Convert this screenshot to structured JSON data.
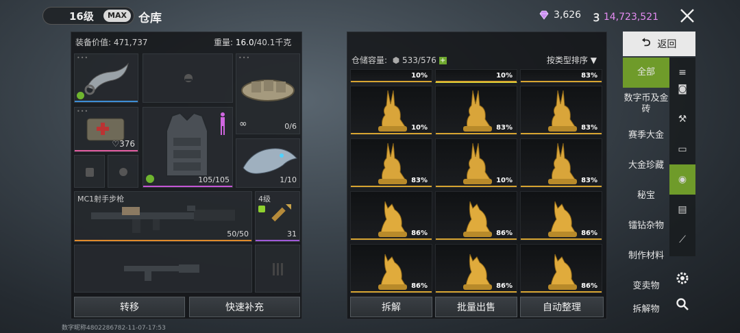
{
  "header": {
    "level": "16级",
    "max_badge": "MAX",
    "title": "仓库",
    "diamonds": "3,626",
    "coins": "14,723,521"
  },
  "left": {
    "equip_value_label": "装备价值:",
    "equip_value": "471,737",
    "weight_label": "重量:",
    "weight_current": "16.0",
    "weight_max": "/40.1千克",
    "slots": {
      "medkit_count": "♡376",
      "belt_count": "0/6",
      "armor_count": "105/105",
      "pet_count": "1/10",
      "infinity": "∞",
      "rifle_name": "MC1射手步枪",
      "rifle_count": "50/50",
      "ammo_level": "4级",
      "ammo_count": "31"
    },
    "transfer_button": "转移",
    "quick_refill_button": "快速补充"
  },
  "right": {
    "capacity_label": "仓储容量:",
    "capacity": "533/576",
    "sort_label": "按类型排序",
    "top_partial": [
      "10%",
      "10%",
      "83%"
    ],
    "rows": [
      {
        "type": "rabbit",
        "values": [
          "10%",
          "83%",
          "83%"
        ]
      },
      {
        "type": "rabbit",
        "values": [
          "83%",
          "10%",
          "83%"
        ]
      },
      {
        "type": "fox",
        "values": [
          "86%",
          "86%",
          "86%"
        ]
      },
      {
        "type": "fox",
        "values": [
          "86%",
          "86%",
          "86%"
        ]
      }
    ],
    "dismantle_button": "拆解",
    "bulk_sell_button": "批量出售",
    "auto_sort_button": "自动整理"
  },
  "sidebar": {
    "back": "返回",
    "categories": [
      "全部",
      "数字币及金砖",
      "赛季大金",
      "大金珍藏",
      "秘宝",
      "镭钻杂物",
      "制作材料",
      "变卖物",
      "拆解物"
    ]
  },
  "footer_note": "数字昵称4802286782-11-07-17:53",
  "colors": {
    "accent_green": "#6f9b2a",
    "gold": "#d8a531",
    "diamond": "#c98cf0",
    "coin_text": "#e58cf2"
  }
}
